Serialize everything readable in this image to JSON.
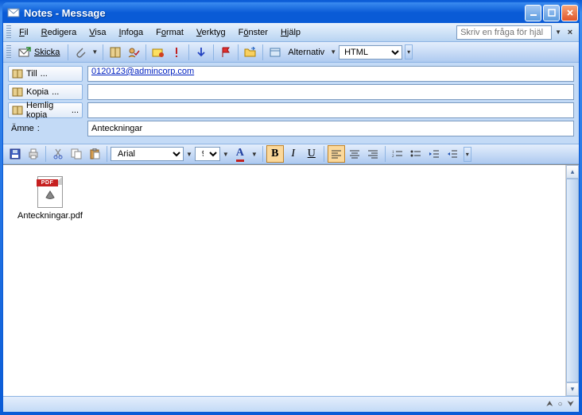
{
  "window": {
    "title": "Notes - Message"
  },
  "menu": {
    "file": "Fil",
    "edit": "Redigera",
    "view": "Visa",
    "insert": "Infoga",
    "format": "Format",
    "tools": "Verktyg",
    "window": "Fönster",
    "help": "Hjälp",
    "help_placeholder": "Skriv en fråga för hjäl"
  },
  "toolbar": {
    "send": "Skicka",
    "options": "Alternativ",
    "msg_format": "HTML"
  },
  "fields": {
    "to_label": "Till",
    "to_value": "0120123@admincorp.com",
    "cc_label": "Kopia",
    "cc_value": "",
    "bcc_label": "Hemlig kopia",
    "bcc_value": "",
    "subject_label": "Ämne",
    "subject_value": "Anteckningar"
  },
  "format_toolbar": {
    "font": "Arial",
    "size": "9"
  },
  "attachment": {
    "name": "Anteckningar.pdf",
    "badge": "PDF"
  }
}
